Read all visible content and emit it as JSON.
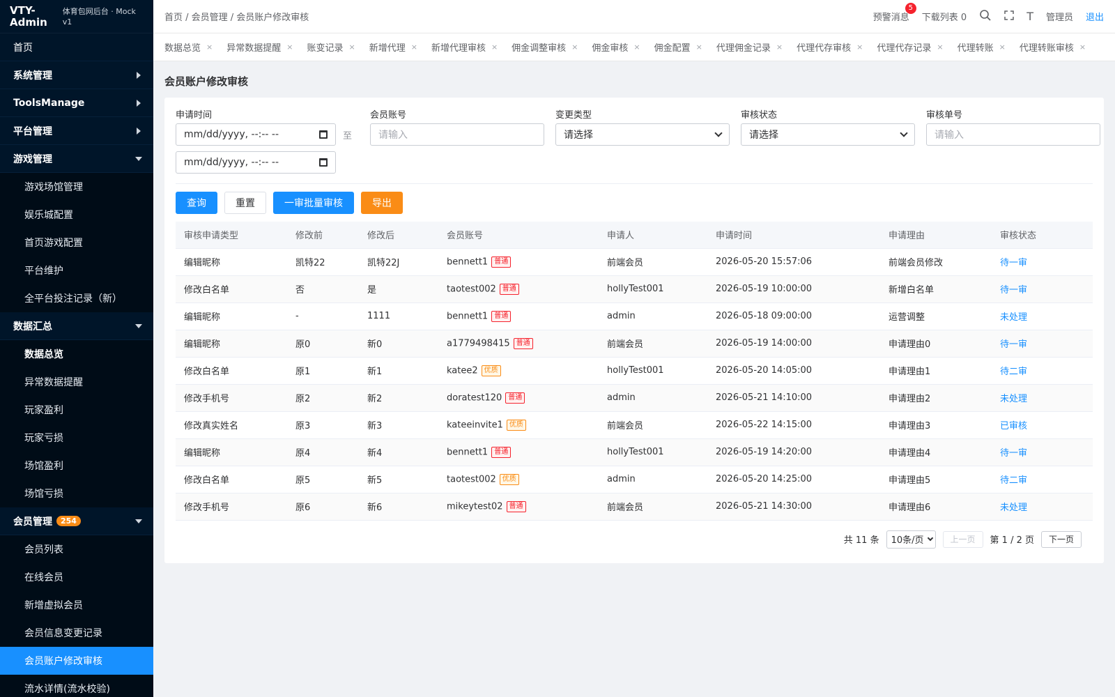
{
  "brand": {
    "name": "VTY-Admin",
    "subtitle": "体育包网后台 · Mock v1"
  },
  "sidebar": {
    "top": [
      {
        "label": "首页",
        "arrow": ""
      },
      {
        "label": "系统管理",
        "arrow": "right"
      },
      {
        "label": "ToolsManage",
        "arrow": "right"
      },
      {
        "label": "平台管理",
        "arrow": "right"
      }
    ],
    "game": {
      "label": "游戏管理",
      "items": [
        "游戏场馆管理",
        "娱乐城配置",
        "首页游戏配置",
        "平台维护",
        "全平台投注记录（新）"
      ]
    },
    "data": {
      "label": "数据汇总",
      "items": [
        "数据总览",
        "异常数据提醒",
        "玩家盈利",
        "玩家亏损",
        "场馆盈利",
        "场馆亏损"
      ]
    },
    "member": {
      "label": "会员管理",
      "badge": "254",
      "items": [
        "会员列表",
        "在线会员",
        "新增虚拟会员",
        "会员信息变更记录",
        "会员账户修改审核",
        "流水详情(流水校验)"
      ]
    }
  },
  "header": {
    "breadcrumb": "首页 / 会员管理 / 会员账户修改审核",
    "alert_label": "预警消息",
    "alert_count": "5",
    "download_label": "下载列表 0",
    "text_icon": "T",
    "admin_label": "管理员",
    "logout_label": "退出"
  },
  "tabs": [
    "数据总览",
    "异常数据提醒",
    "账变记录",
    "新增代理",
    "新增代理审核",
    "佣金调整审核",
    "佣金审核",
    "佣金配置",
    "代理佣金记录",
    "代理代存审核",
    "代理代存记录",
    "代理转账",
    "代理转账审核"
  ],
  "page": {
    "title": "会员账户修改审核"
  },
  "filters": {
    "apply_time_label": "申请时间",
    "date_placeholder": "mm/dd/yyyy, --:-- --",
    "date_sep": "至",
    "account_label": "会员账号",
    "account_placeholder": "请输入",
    "change_type_label": "变更类型",
    "change_type_value": "请选择",
    "status_label": "审核状态",
    "status_value": "请选择",
    "order_label": "审核单号",
    "order_placeholder": "请输入"
  },
  "actions": {
    "query": "查询",
    "reset": "重置",
    "batch": "一审批量审核",
    "export": "导出"
  },
  "table": {
    "headers": [
      "审核申请类型",
      "修改前",
      "修改后",
      "会员账号",
      "申请人",
      "申请时间",
      "申请理由",
      "审核状态"
    ],
    "rows": [
      {
        "type": "编辑昵称",
        "before": "凯特22",
        "after": "凯特22J",
        "account": "bennett1",
        "tag": "普通",
        "tag_kind": "normal",
        "applicant": "前端会员",
        "time": "2026-05-20 15:57:06",
        "reason": "前端会员修改",
        "status": "待一审"
      },
      {
        "type": "修改白名单",
        "before": "否",
        "after": "是",
        "account": "taotest002",
        "tag": "普通",
        "tag_kind": "normal",
        "applicant": "hollyTest001",
        "time": "2026-05-19 10:00:00",
        "reason": "新增白名单",
        "status": "待一审"
      },
      {
        "type": "编辑昵称",
        "before": "-",
        "after": "1111",
        "account": "bennett1",
        "tag": "普通",
        "tag_kind": "normal",
        "applicant": "admin",
        "time": "2026-05-18 09:00:00",
        "reason": "运营调整",
        "status": "未处理"
      },
      {
        "type": "编辑昵称",
        "before": "原0",
        "after": "新0",
        "account": "a1779498415",
        "tag": "普通",
        "tag_kind": "normal",
        "applicant": "前端会员",
        "time": "2026-05-19 14:00:00",
        "reason": "申请理由0",
        "status": "待一审"
      },
      {
        "type": "修改白名单",
        "before": "原1",
        "after": "新1",
        "account": "katee2",
        "tag": "优质",
        "tag_kind": "good",
        "applicant": "hollyTest001",
        "time": "2026-05-20 14:05:00",
        "reason": "申请理由1",
        "status": "待二审"
      },
      {
        "type": "修改手机号",
        "before": "原2",
        "after": "新2",
        "account": "doratest120",
        "tag": "普通",
        "tag_kind": "normal",
        "applicant": "admin",
        "time": "2026-05-21 14:10:00",
        "reason": "申请理由2",
        "status": "未处理"
      },
      {
        "type": "修改真实姓名",
        "before": "原3",
        "after": "新3",
        "account": "kateeinvite1",
        "tag": "优质",
        "tag_kind": "good",
        "applicant": "前端会员",
        "time": "2026-05-22 14:15:00",
        "reason": "申请理由3",
        "status": "已审核"
      },
      {
        "type": "编辑昵称",
        "before": "原4",
        "after": "新4",
        "account": "bennett1",
        "tag": "普通",
        "tag_kind": "normal",
        "applicant": "hollyTest001",
        "time": "2026-05-19 14:20:00",
        "reason": "申请理由4",
        "status": "待一审"
      },
      {
        "type": "修改白名单",
        "before": "原5",
        "after": "新5",
        "account": "taotest002",
        "tag": "优质",
        "tag_kind": "good",
        "applicant": "admin",
        "time": "2026-05-20 14:25:00",
        "reason": "申请理由5",
        "status": "待二审"
      },
      {
        "type": "修改手机号",
        "before": "原6",
        "after": "新6",
        "account": "mikeytest02",
        "tag": "普通",
        "tag_kind": "normal",
        "applicant": "前端会员",
        "time": "2026-05-21 14:30:00",
        "reason": "申请理由6",
        "status": "未处理"
      }
    ]
  },
  "pager": {
    "total": "共 11 条",
    "page_size": "10条/页",
    "prev": "上一页",
    "page_info": "第 1 / 2 页",
    "next": "下一页"
  },
  "colors": {
    "sidebar_bg": "#001529",
    "primary": "#1890ff",
    "warn": "#fa8c16",
    "danger": "#f5222d"
  }
}
